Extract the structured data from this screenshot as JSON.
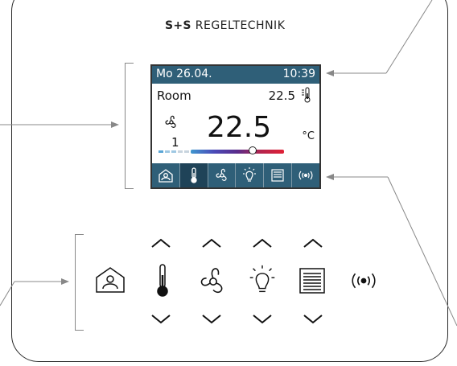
{
  "brand": {
    "bold_part": "S+S",
    "rest": " REGELTECHNIK"
  },
  "display": {
    "date": "Mo 26.04.",
    "time": "10:39",
    "room_label": "Room",
    "setpoint": "22.5",
    "temperature": "22.5",
    "unit": "°C",
    "fan_level": "1",
    "selected_tab": "temperature"
  },
  "display_tabs": [
    "home-icon",
    "thermometer-icon",
    "fan-icon",
    "light-bulb-icon",
    "blinds-icon",
    "wireless-icon"
  ],
  "buttons": [
    "home-icon",
    "thermometer-icon",
    "fan-icon",
    "light-bulb-icon",
    "blinds-icon",
    "wireless-icon"
  ],
  "colors": {
    "screen_bar": "#2f5f78",
    "tab_active": "#1f4358",
    "temp_gradient_low": "#3f97cf",
    "temp_gradient_high": "#e02035",
    "fan_level_bar": "#5aa6d6"
  }
}
